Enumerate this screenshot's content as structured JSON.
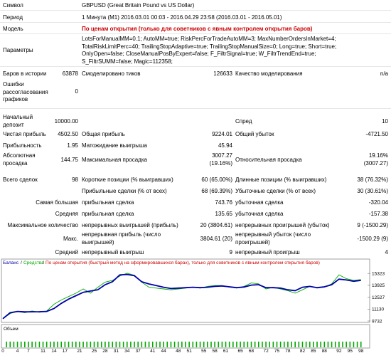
{
  "report": {
    "symbol": {
      "label": "Символ",
      "value": "GBPUSD (Great Britain Pound vs US Dollar)"
    },
    "period": {
      "label": "Период",
      "value": "1 Минута (M1) 2016.03.01 00:03 - 2016.04.29 23:58 (2016.03.01 - 2016.05.01)"
    },
    "model": {
      "label": "Модель",
      "value": "По ценам открытия (только для советников с явным контролем открытия баров)"
    },
    "params": {
      "label": "Параметры",
      "lines": [
        "LotsForManualMM=0.1; AutoMM=true; RiskPercForTradeAutoMM=3; MaxNumberOrdersInMarket=4;",
        "TotalRiskLimitPerc=40; TrailingStopAdaptive=true; TrailingStopManualSize=0; Long=true; Short=true;",
        "OnlyOpen=false; CloseManualPosByExpert=false; F_FiltrSignal=true; W_FiltrTrendEnd=true;",
        "S_FiltrSUMM=false; Magic=112358;"
      ]
    },
    "bars": {
      "label": "Баров в истории",
      "value": "63878"
    },
    "ticks": {
      "label": "Смоделировано тиков",
      "value": "126633"
    },
    "quality": {
      "label": "Качество моделирования",
      "value": "n/a"
    },
    "errors": {
      "label_lines": [
        "Ошибки",
        "рассогласования",
        "графиков"
      ],
      "value": "0"
    },
    "deposit": {
      "label_lines": [
        "Начальный",
        "депозит"
      ],
      "value": "10000.00"
    },
    "spread": {
      "label": "Спред",
      "value": "10"
    },
    "net_profit": {
      "label": "Чистая прибыль",
      "value": "4502.50"
    },
    "gross_profit": {
      "label": "Общая прибыль",
      "value": "9224.01"
    },
    "gross_loss": {
      "label": "Общий убыток",
      "value": "-4721.50"
    },
    "profit_factor": {
      "label": "Прибыльность",
      "value": "1.95"
    },
    "expected_payoff": {
      "label": "Матожидание выигрыша",
      "value": "45.94"
    },
    "abs_drawdown": {
      "label_lines": [
        "Абсолютная",
        "просадка"
      ],
      "value": "144.75"
    },
    "max_drawdown": {
      "label": "Максимальная просадка",
      "value_lines": [
        "3007.27",
        "(19.16%)"
      ]
    },
    "rel_drawdown": {
      "label": "Относительная просадка",
      "value_lines": [
        "19.16%",
        "(3007.27)"
      ]
    },
    "total_trades": {
      "label": "Всего сделок",
      "value": "98"
    },
    "short_pos": {
      "label": "Короткие позиции (% выигравших)",
      "value": "60 (65.00%)"
    },
    "long_pos": {
      "label": "Длинные позиции (% выигравших)",
      "value": "38 (76.32%)"
    },
    "profit_trades": {
      "label": "Прибыльные сделки (% от всех)",
      "value": "68 (69.39%)"
    },
    "loss_trades": {
      "label": "Убыточные сделки (% от всех)",
      "value": "30 (30.61%)"
    },
    "largest": {
      "label": "Самая большая",
      "profit_label": "прибыльная сделка",
      "profit": "743.76",
      "loss_label": "убыточная сделка",
      "loss": "-320.04"
    },
    "average": {
      "label": "Средняя",
      "profit_label": "прибыльная сделка",
      "profit": "135.65",
      "loss_label": "убыточная сделка",
      "loss": "-157.38"
    },
    "max_count": {
      "label": "Максимальное количество",
      "wins_label": "непрерывных выигрышей (прибыль)",
      "wins": "20 (3804.61)",
      "losses_label": "непрерывных проигрышей (убыток)",
      "losses": "9 (-1500.29)"
    },
    "max_value": {
      "label": "Макс.",
      "profit_label_lines": [
        "непрерывная прибыль (число",
        "выигрышей)"
      ],
      "profit": "3804.61 (20)",
      "loss_label_lines": [
        "непрерывный убыток (число",
        "проигрышей)"
      ],
      "loss": "-1500.29 (9)"
    },
    "avg_cons": {
      "label": "Средний",
      "wins_label": "непрерывный выигрыш",
      "wins": "9",
      "losses_label": "непрерывный проигрыш",
      "losses": "4"
    }
  },
  "chart_data": {
    "type": "line",
    "legend": [
      {
        "name": "Баланс",
        "color": "#0000aa"
      },
      {
        "name": "Средства",
        "color": "#00aa00"
      }
    ],
    "legend_note": "По ценам открытия (быстрый метод на сформировавшихся барах), только для советников с явным контролем открытия баров)",
    "ylim": [
      9732,
      15923
    ],
    "y_ticks": [
      "15323",
      "13925",
      "12527",
      "11130",
      "9732"
    ],
    "x_ticks": [
      "0",
      "4",
      "7",
      "11",
      "14",
      "17",
      "21",
      "25",
      "28",
      "31",
      "34",
      "37",
      "41",
      "44",
      "48",
      "51",
      "55",
      "58",
      "61",
      "65",
      "68",
      "72",
      "75",
      "78",
      "82",
      "85",
      "88",
      "92",
      "95",
      "98"
    ],
    "volume_label": "Объем",
    "x": [
      0,
      2,
      4,
      6,
      8,
      10,
      12,
      14,
      16,
      18,
      20,
      22,
      24,
      26,
      28,
      30,
      32,
      34,
      36,
      38,
      40,
      42,
      44,
      46,
      48,
      50,
      52,
      54,
      56,
      58,
      60,
      62,
      64,
      66,
      68,
      70,
      72,
      74,
      76,
      78,
      80,
      82,
      84,
      86,
      88,
      90,
      92,
      94,
      96,
      98
    ],
    "balance": [
      10000,
      10700,
      10850,
      10800,
      10810,
      10820,
      10850,
      11200,
      11800,
      12300,
      12700,
      13100,
      13250,
      13400,
      14000,
      14350,
      15150,
      15200,
      15050,
      14350,
      14080,
      13900,
      13700,
      13550,
      13600,
      13650,
      13700,
      13650,
      13700,
      13800,
      13850,
      13750,
      13650,
      13720,
      13950,
      14000,
      13650,
      13650,
      13600,
      13400,
      13300,
      13700,
      13800,
      13650,
      13750,
      14000,
      14650,
      14550,
      14400,
      14500
    ],
    "equity": [
      10000,
      10600,
      10850,
      10700,
      10900,
      10750,
      10900,
      11700,
      12200,
      12600,
      13000,
      13500,
      13000,
      13700,
      14300,
      14500,
      15000,
      15350,
      15100,
      14300,
      13700,
      13600,
      13500,
      13400,
      13500,
      13600,
      13700,
      13600,
      13800,
      13900,
      13900,
      13700,
      13600,
      13800,
      14200,
      14100,
      13500,
      13700,
      13500,
      13300,
      13000,
      13400,
      13800,
      13600,
      13700,
      14100,
      15150,
      14700,
      14500,
      14600
    ]
  }
}
